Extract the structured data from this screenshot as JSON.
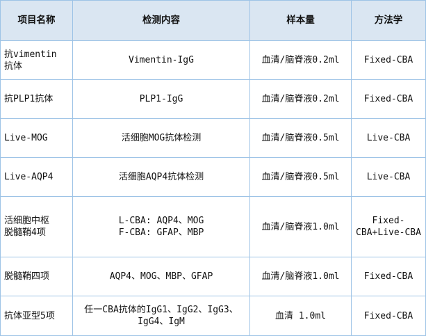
{
  "headers": [
    "项目名称",
    "检测内容",
    "样本量",
    "方法学"
  ],
  "rows": [
    {
      "name": [
        "抗vimentin",
        "抗体"
      ],
      "content": [
        "Vimentin-IgG"
      ],
      "sample": [
        "血清/脑脊液0.2ml"
      ],
      "method": [
        "Fixed-CBA"
      ]
    },
    {
      "name": [
        "抗PLP1抗体"
      ],
      "content": [
        "PLP1-IgG"
      ],
      "sample": [
        "血清/脑脊液0.2ml"
      ],
      "method": [
        "Fixed-CBA"
      ]
    },
    {
      "name": [
        "Live-MOG"
      ],
      "content": [
        "活细胞MOG抗体检测"
      ],
      "sample": [
        "血清/脑脊液0.5ml"
      ],
      "method": [
        "Live-CBA"
      ]
    },
    {
      "name": [
        "Live-AQP4"
      ],
      "content": [
        "活细胞AQP4抗体检测"
      ],
      "sample": [
        "血清/脑脊液0.5ml"
      ],
      "method": [
        "Live-CBA"
      ]
    },
    {
      "name": [
        "活细胞中枢",
        "脱髓鞘4项"
      ],
      "content": [
        "L-CBA: AQP4、MOG",
        "F-CBA: GFAP、MBP"
      ],
      "sample": [
        "血清/脑脊液1.0ml"
      ],
      "method": [
        "Fixed-",
        "CBA+Live-CBA"
      ]
    },
    {
      "name": [
        "脱髓鞘四项"
      ],
      "content": [
        "AQP4、MOG、MBP、GFAP"
      ],
      "sample": [
        "血清/脑脊液1.0ml"
      ],
      "method": [
        "Fixed-CBA"
      ]
    },
    {
      "name": [
        "抗体亚型5项"
      ],
      "content": [
        "任一CBA抗体的IgG1、IgG2、IgG3、",
        "IgG4、IgM"
      ],
      "sample": [
        "血清 1.0ml"
      ],
      "method": [
        "Fixed-CBA"
      ]
    }
  ]
}
